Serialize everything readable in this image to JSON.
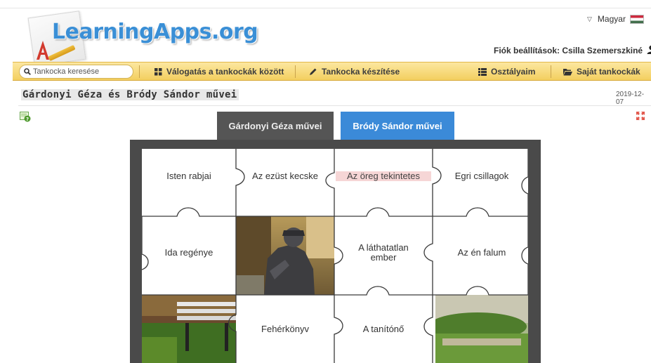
{
  "header": {
    "logo_text": "LearningApps.org",
    "language": "Magyar",
    "account_label": "Fiók beállítások: Csilla Szemerszkiné"
  },
  "nav": {
    "search_placeholder": "Tankocka keresése",
    "items": [
      {
        "label": "Válogatás a tankockák között",
        "icon": "grid-icon"
      },
      {
        "label": "Tankocka készítése",
        "icon": "pencil-icon"
      },
      {
        "label": "Osztályaim",
        "icon": "list-icon"
      },
      {
        "label": "Saját tankockák",
        "icon": "folder-icon"
      }
    ]
  },
  "page": {
    "title": "Gárdonyi Géza és Bródy Sándor művei",
    "date": "2019-12-07"
  },
  "tabs": [
    {
      "label": "Gárdonyi Géza művei",
      "active": false
    },
    {
      "label": "Bródy Sándor művei",
      "active": true
    }
  ],
  "pieces": [
    {
      "label": "Isten rabjai",
      "highlighted": false
    },
    {
      "label": "Az ezüst kecske",
      "highlighted": false
    },
    {
      "label": "Az öreg tekintetes",
      "highlighted": true
    },
    {
      "label": "Egri csillagok",
      "highlighted": false
    },
    {
      "label": "Ida regénye",
      "highlighted": false
    },
    {
      "label": "A láthatatlan ember",
      "highlighted": false
    },
    {
      "label": "Az én falum",
      "highlighted": false
    },
    {
      "label": "Fehérkönyv",
      "highlighted": false
    },
    {
      "label": "A tanítónő",
      "highlighted": false
    }
  ],
  "colors": {
    "nav_bg": "#f3cf5f",
    "tab_active": "#3b8ad8",
    "tab_inactive": "#555555",
    "board": "#4a4a4a",
    "logo": "#3a8fd6"
  }
}
